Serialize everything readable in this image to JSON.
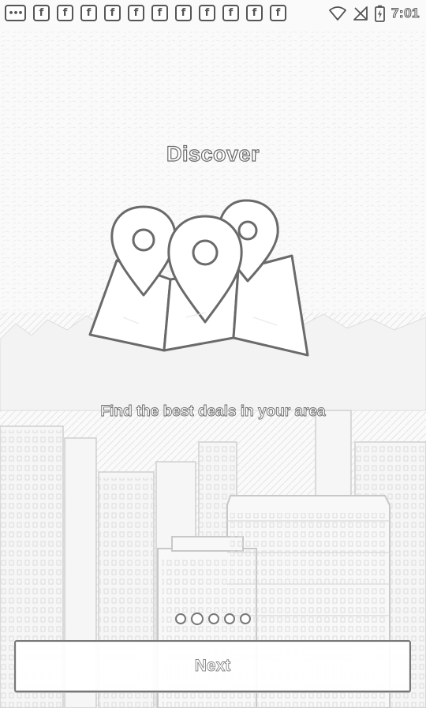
{
  "status_bar": {
    "notifications": [
      {
        "icon": "more-icon",
        "glyph": "•••"
      },
      {
        "icon": "facebook-icon",
        "glyph": "f"
      },
      {
        "icon": "facebook-icon",
        "glyph": "f"
      },
      {
        "icon": "facebook-icon",
        "glyph": "f"
      },
      {
        "icon": "facebook-icon",
        "glyph": "f"
      },
      {
        "icon": "facebook-icon",
        "glyph": "f"
      },
      {
        "icon": "facebook-icon",
        "glyph": "f"
      },
      {
        "icon": "facebook-icon",
        "glyph": "f"
      },
      {
        "icon": "facebook-icon",
        "glyph": "f"
      },
      {
        "icon": "facebook-icon",
        "glyph": "f"
      },
      {
        "icon": "facebook-icon",
        "glyph": "f"
      },
      {
        "icon": "facebook-icon",
        "glyph": "f"
      }
    ],
    "system_icons": [
      "wifi-icon",
      "no-signal-icon",
      "battery-charging-icon"
    ],
    "time": "7:01"
  },
  "onboarding": {
    "title": "Discover",
    "icon": "map-pins-icon",
    "subtitle": "Find the best deals in your area",
    "pages": 5,
    "current_page": 2,
    "next_label": "Next"
  },
  "colors": {
    "outline": "#6a6a6a",
    "background": "#fafafa"
  }
}
